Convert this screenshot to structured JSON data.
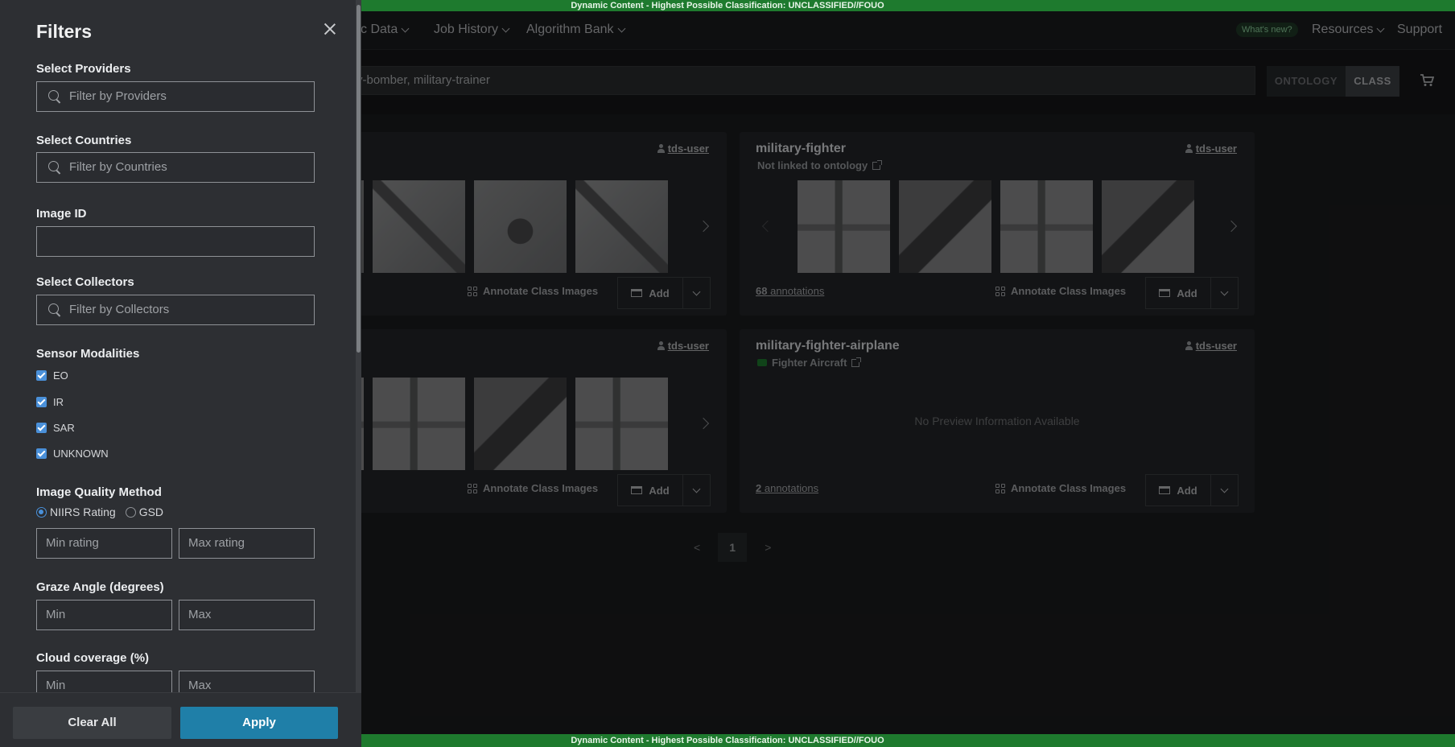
{
  "banner": {
    "text": "Dynamic Content - Highest Possible Classification: UNCLASSIFIED//FOUO"
  },
  "nav": {
    "items": [
      {
        "label": "tic Data"
      },
      {
        "label": "Job History"
      },
      {
        "label": "Algorithm Bank"
      }
    ],
    "whats_new": "What's new?",
    "resources": "Resources",
    "support": "Support"
  },
  "search": {
    "value": "y-bomber, military-trainer",
    "toggle_ontology": "ONTOLOGY",
    "toggle_class": "CLASS"
  },
  "cards": [
    {
      "owner": "tds-user",
      "annotate_label": "Annotate Class Images",
      "add_label": "Add"
    },
    {
      "title": "military-fighter",
      "subtitle": "Not linked to ontology",
      "owner": "tds-user",
      "annotations_count": "68",
      "annotations_label": "annotations",
      "annotate_label": "Annotate Class Images",
      "add_label": "Add"
    },
    {
      "owner": "tds-user",
      "annotate_label": "Annotate Class Images",
      "add_label": "Add"
    },
    {
      "title": "military-fighter-airplane",
      "subtitle": "Fighter Aircraft",
      "owner": "tds-user",
      "no_preview": "No Preview Information Available",
      "annotations_count": "2",
      "annotations_label": "annotations",
      "annotate_label": "Annotate Class Images",
      "add_label": "Add"
    }
  ],
  "pager": {
    "prev": "<",
    "current": "1",
    "next": ">"
  },
  "filters": {
    "title": "Filters",
    "providers": {
      "label": "Select Providers",
      "placeholder": "Filter by Providers"
    },
    "countries": {
      "label": "Select Countries",
      "placeholder": "Filter by Countries"
    },
    "image_id": {
      "label": "Image ID",
      "value": ""
    },
    "collectors": {
      "label": "Select Collectors",
      "placeholder": "Filter by Collectors"
    },
    "sensor": {
      "label": "Sensor Modalities",
      "options": [
        {
          "label": "EO",
          "checked": true
        },
        {
          "label": "IR",
          "checked": true
        },
        {
          "label": "SAR",
          "checked": true
        },
        {
          "label": "UNKNOWN",
          "checked": true
        }
      ]
    },
    "quality": {
      "label": "Image Quality Method",
      "radio_niirs": "NIIRS Rating",
      "radio_gsd": "GSD",
      "selected": "NIIRS Rating",
      "min_placeholder": "Min rating",
      "max_placeholder": "Max rating"
    },
    "graze": {
      "label": "Graze Angle (degrees)",
      "min_placeholder": "Min",
      "max_placeholder": "Max"
    },
    "cloud": {
      "label": "Cloud coverage (%)",
      "min_placeholder": "Min",
      "max_placeholder": "Max"
    },
    "clear_all": "Clear All",
    "apply": "Apply"
  }
}
